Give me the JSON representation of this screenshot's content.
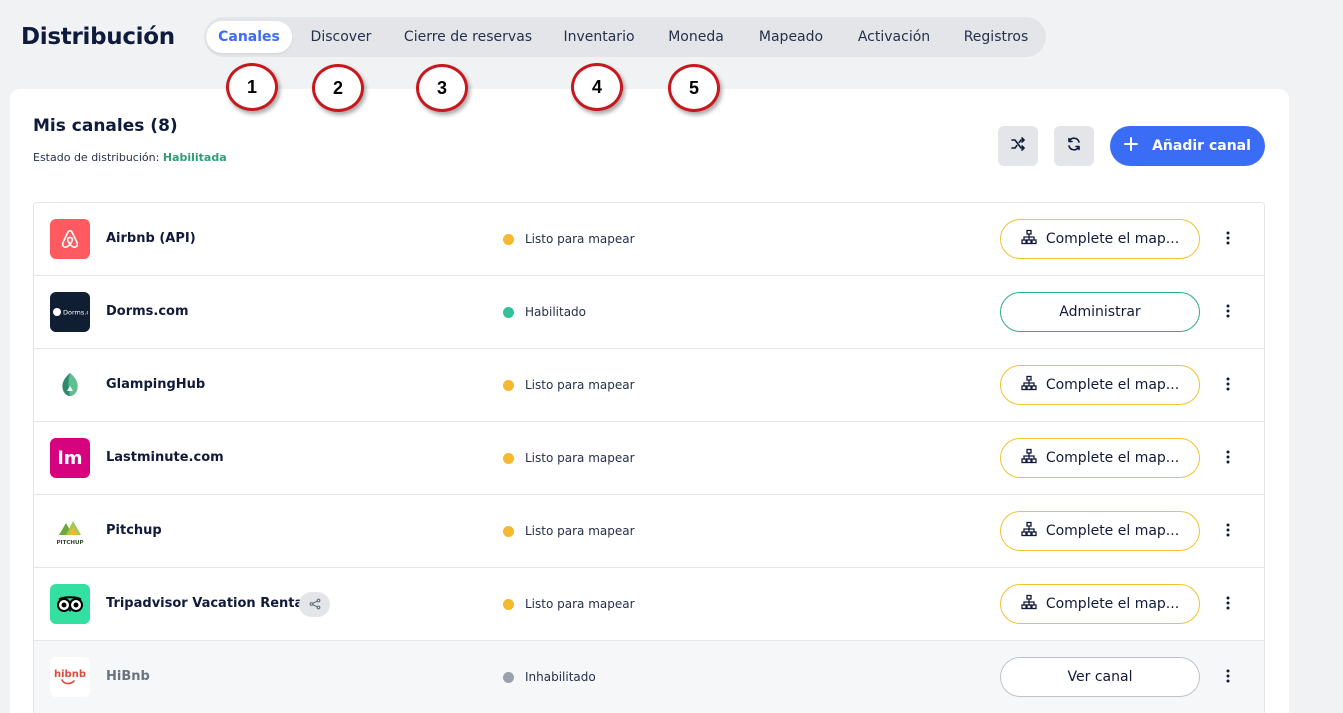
{
  "page": {
    "title": "Distribución"
  },
  "tabs": [
    {
      "label": "Canales",
      "active": true
    },
    {
      "label": "Discover",
      "active": false
    },
    {
      "label": "Cierre de reservas",
      "active": false
    },
    {
      "label": "Inventario",
      "active": false
    },
    {
      "label": "Moneda",
      "active": false
    },
    {
      "label": "Mapeado",
      "active": false
    },
    {
      "label": "Activación",
      "active": false
    },
    {
      "label": "Registros",
      "active": false
    }
  ],
  "markers": [
    "1",
    "2",
    "3",
    "4",
    "5"
  ],
  "channels_card": {
    "title": "Mis canales (8)",
    "status_label": "Estado de distribución:",
    "status_value": "Habilitada",
    "shuffle_icon": "shuffle-icon",
    "refresh_icon": "refresh-icon",
    "add_button": "Añadir canal"
  },
  "colors": {
    "accent": "#3a6cf6",
    "ready": "#f5b82e",
    "enabled": "#33c19a",
    "disabled": "#9aa1ac"
  },
  "channels": [
    {
      "name": "Airbnb (API)",
      "status": "Listo para mapear",
      "status_kind": "ready",
      "action": "Complete el map...",
      "action_kind": "map",
      "logo": "airbnb-logo"
    },
    {
      "name": "Dorms.com",
      "status": "Habilitado",
      "status_kind": "enabled",
      "action": "Administrar",
      "action_kind": "manage",
      "logo": "dorms-logo",
      "logo_text": "Dorms.com"
    },
    {
      "name": "GlampingHub",
      "status": "Listo para mapear",
      "status_kind": "ready",
      "action": "Complete el map...",
      "action_kind": "map",
      "logo": "glampinghub-logo"
    },
    {
      "name": "Lastminute.com",
      "status": "Listo para mapear",
      "status_kind": "ready",
      "action": "Complete el map...",
      "action_kind": "map",
      "logo": "lastminute-logo",
      "logo_text": "lm"
    },
    {
      "name": "Pitchup",
      "status": "Listo para mapear",
      "status_kind": "ready",
      "action": "Complete el map...",
      "action_kind": "map",
      "logo": "pitchup-logo",
      "logo_text": "PITCHUP"
    },
    {
      "name": "Tripadvisor Vacation Rentals",
      "status": "Listo para mapear",
      "status_kind": "ready",
      "action": "Complete el map...",
      "action_kind": "map",
      "logo": "tripadvisor-logo",
      "share_icon": "share-icon"
    },
    {
      "name": "HiBnb",
      "status": "Inhabilitado",
      "status_kind": "disabled",
      "action": "Ver canal",
      "action_kind": "view",
      "logo": "hibnb-logo",
      "logo_text": "hibnb"
    }
  ]
}
